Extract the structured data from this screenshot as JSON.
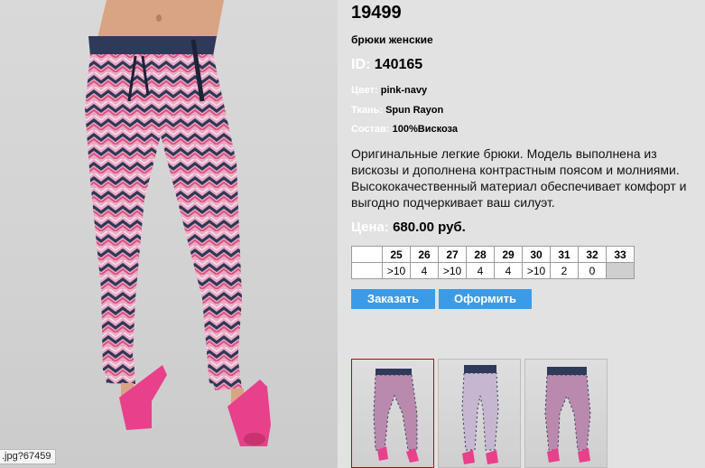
{
  "product": {
    "sku": "19499",
    "subtitle": "брюки женские",
    "id_label": "ID:",
    "id_value": "140165",
    "attributes": [
      {
        "label": "Цвет:",
        "value": "pink-navy"
      },
      {
        "label": "Ткань:",
        "value": "Spun Rayon"
      },
      {
        "label": "Состав:",
        "value": "100%Вискоза"
      }
    ],
    "description": "Оригинальные легкие брюки. Модель выполнена из вискозы и дополнена контрастным поясом и молниями. Высококачественный материал обеспечивает комфорт и выгодно подчеркивает ваш силуэт.",
    "price_label": "Цена:",
    "price_value": "680.00 руб."
  },
  "sizes": {
    "headers": [
      "25",
      "26",
      "27",
      "28",
      "29",
      "30",
      "31",
      "32",
      "33"
    ],
    "stock": [
      ">10",
      "4",
      ">10",
      "4",
      "4",
      ">10",
      "2",
      "0",
      ""
    ]
  },
  "buttons": {
    "order": "Заказать",
    "checkout": "Оформить"
  },
  "status_tooltip": ".jpg?67459",
  "colors": {
    "panel_bg": "#e2e2e2",
    "button_blue": "#3c9be6",
    "pink": "#e58bb0",
    "navy": "#2e3856",
    "shoe_pink": "#e8408a",
    "active_thumb_border": "#c40000"
  }
}
